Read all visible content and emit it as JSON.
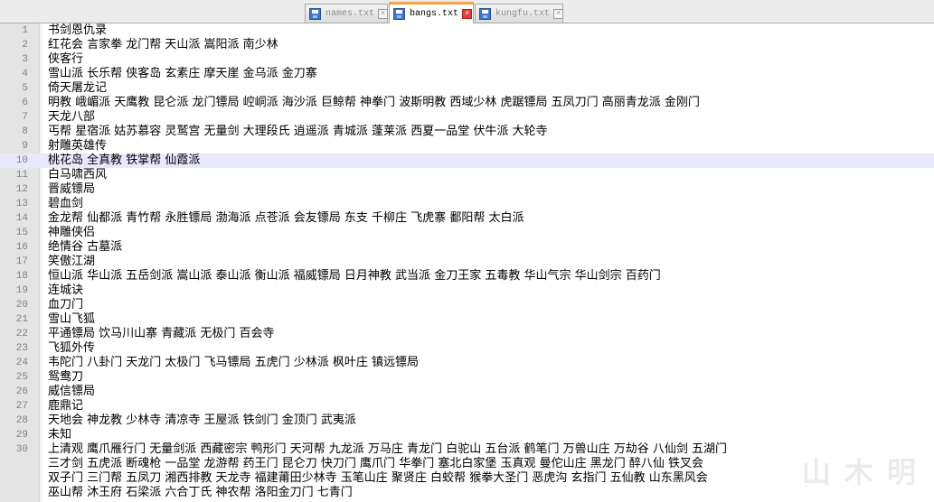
{
  "tabs": [
    {
      "label": "names.txt",
      "active": false
    },
    {
      "label": "bangs.txt",
      "active": true
    },
    {
      "label": "kungfu.txt",
      "active": false
    }
  ],
  "icons": {
    "tab_file": "save-icon",
    "tab_close": "close-icon"
  },
  "colors": {
    "active_tab_accent": "#f6a14a",
    "current_line": "#e8e8ff",
    "gutter": "#e4e4e4"
  },
  "current_line": 10,
  "lines": [
    {
      "number": "1",
      "text": "书剑恩仇录"
    },
    {
      "number": "2",
      "text": "红花会 言家拳 龙门帮 天山派 嵩阳派 南少林"
    },
    {
      "number": "3",
      "text": "侠客行"
    },
    {
      "number": "4",
      "text": "雪山派 长乐帮 侠客岛 玄素庄 摩天崖 金乌派 金刀寨"
    },
    {
      "number": "5",
      "text": "倚天屠龙记"
    },
    {
      "number": "6",
      "text": "明教 峨嵋派 天鹰教 昆仑派 龙门镖局 崆峒派 海沙派 巨鲸帮 神拳门 波斯明教 西域少林 虎踞镖局 五凤刀门 高丽青龙派 金刚门"
    },
    {
      "number": "7",
      "text": "天龙八部"
    },
    {
      "number": "8",
      "text": "丐帮 星宿派 姑苏慕容 灵鹫宫 无量剑 大理段氏 逍遥派 青城派 蓬莱派 西夏一品堂 伏牛派 大轮寺"
    },
    {
      "number": "9",
      "text": "射雕英雄传"
    },
    {
      "number": "10",
      "text": "桃花岛 全真教 铁掌帮 仙霞派"
    },
    {
      "number": "11",
      "text": "白马啸西风"
    },
    {
      "number": "12",
      "text": "晋威镖局"
    },
    {
      "number": "13",
      "text": "碧血剑"
    },
    {
      "number": "14",
      "text": "金龙帮 仙都派 青竹帮 永胜镖局 渤海派 点苍派 会友镖局 东支 千柳庄 飞虎寨 鄱阳帮 太白派"
    },
    {
      "number": "15",
      "text": "神雕侠侣"
    },
    {
      "number": "16",
      "text": "绝情谷 古墓派"
    },
    {
      "number": "17",
      "text": "笑傲江湖"
    },
    {
      "number": "18",
      "text": "恒山派 华山派 五岳剑派 嵩山派 泰山派 衡山派 福威镖局 日月神教 武当派 金刀王家 五毒教 华山气宗 华山剑宗 百药门"
    },
    {
      "number": "19",
      "text": "连城诀"
    },
    {
      "number": "20",
      "text": "血刀门"
    },
    {
      "number": "21",
      "text": "雪山飞狐"
    },
    {
      "number": "22",
      "text": "平通镖局 饮马川山寨 青藏派 无极门 百会寺"
    },
    {
      "number": "23",
      "text": "飞狐外传"
    },
    {
      "number": "24",
      "text": "韦陀门 八卦门 天龙门 太极门 飞马镖局 五虎门 少林派 枫叶庄 镇远镖局"
    },
    {
      "number": "25",
      "text": "鸳鸯刀"
    },
    {
      "number": "26",
      "text": "威信镖局"
    },
    {
      "number": "27",
      "text": "鹿鼎记"
    },
    {
      "number": "28",
      "text": "天地会 神龙教 少林寺 清凉寺 王屋派 铁剑门 金顶门 武夷派"
    },
    {
      "number": "29",
      "text": "未知"
    },
    {
      "number": "30",
      "text": "上清观 鹰爪雁行门 无量剑派 西藏密宗 鸭形门 天河帮 九龙派 万马庄 青龙门 白驼山 五台派 鹤笔门 万兽山庄 万劫谷 八仙剑 五湖门"
    },
    {
      "number": "",
      "text": "三才剑 五虎派 断魂枪 一品堂 龙游帮 药王门 昆仑刀 快刀门 鹰爪门 华拳门 塞北白家堡 玉真观 曼佗山庄 黑龙门 醉八仙 铁叉会"
    },
    {
      "number": "",
      "text": "双子门 三门帮 五凤刀 湘西排教 天龙寺 福建莆田少林寺 玉笔山庄 聚贤庄 白蛟帮 猴拳大圣门 恶虎沟 玄指门 五仙教 山东黑风会"
    },
    {
      "number": "",
      "text": "巫山帮 沐王府 石梁派 六合丁氏 神农帮 洛阳金刀门 七青门"
    }
  ]
}
